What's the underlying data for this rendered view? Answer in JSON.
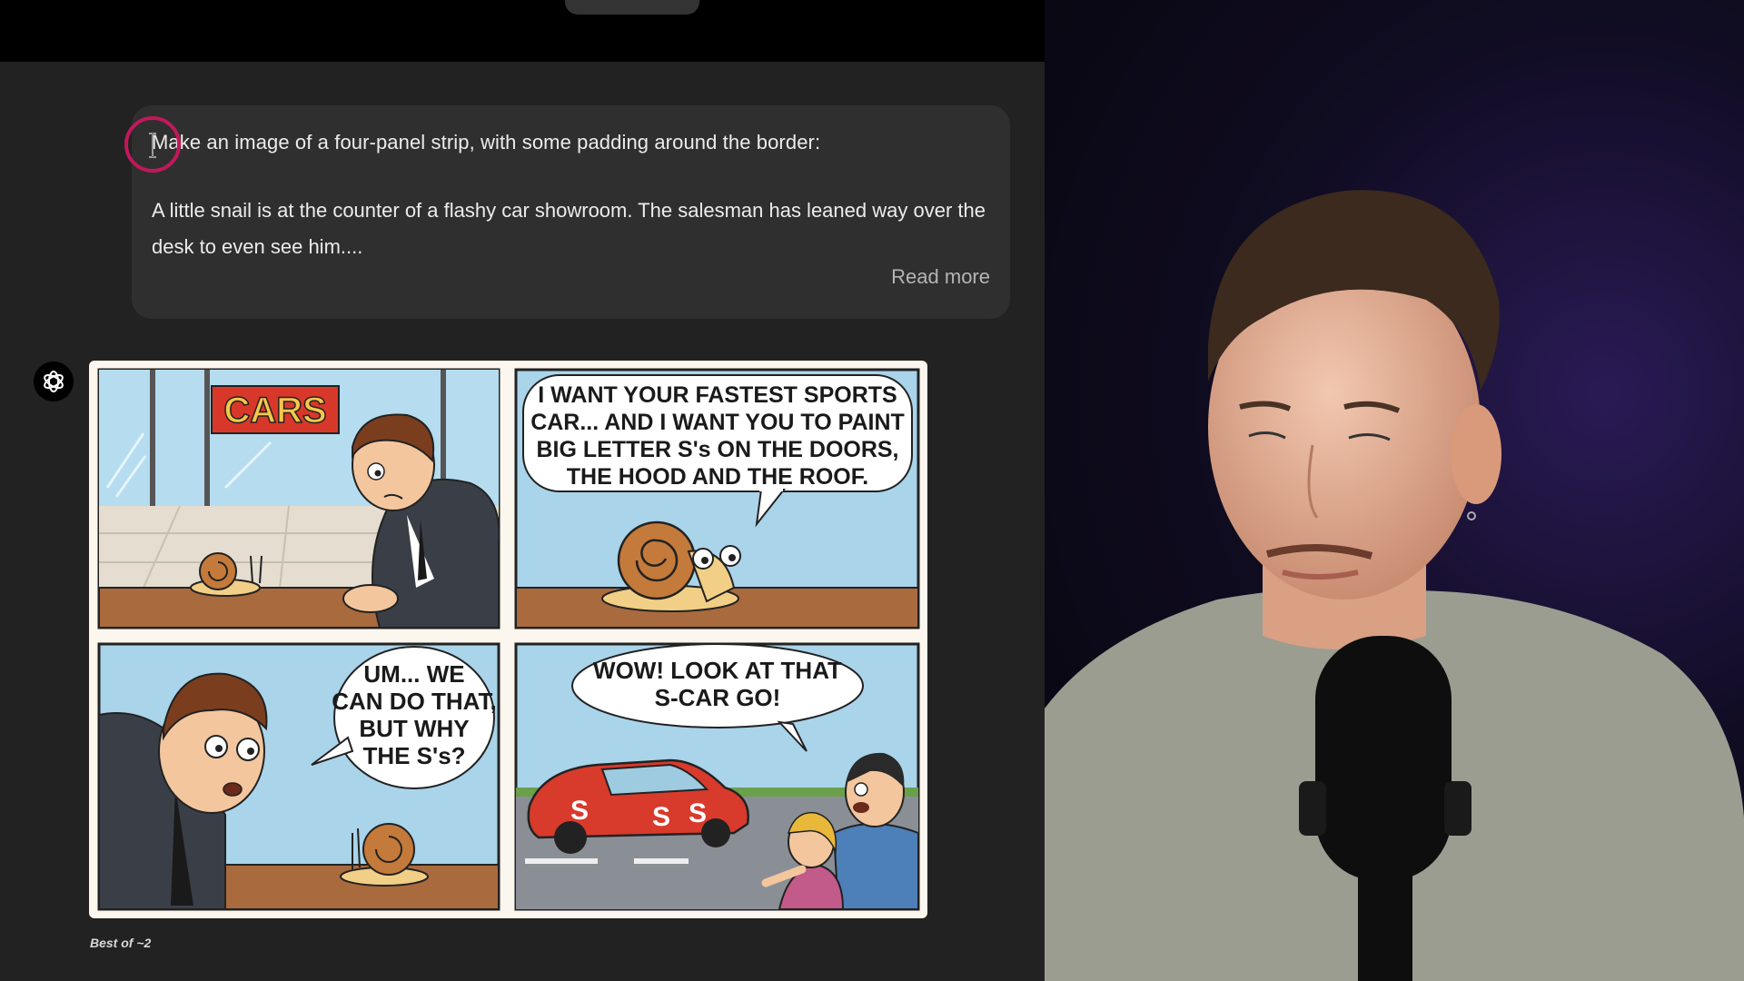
{
  "user_message": {
    "line1": "Make an image of a four-panel strip, with some padding around the border:",
    "body": "A little snail is at the counter of a flashy car showroom. The salesman has leaned way over the desk to even see him....",
    "read_more": "Read more"
  },
  "assistant": {
    "avatar_icon": "openai-logo-icon",
    "image_footer": "Best of ~2"
  },
  "comic": {
    "panel1": {
      "sign": "CARS"
    },
    "panel2": {
      "bubble": [
        "I WANT YOUR FASTEST SPORTS",
        "CAR... AND I WANT YOU TO PAINT",
        "BIG LETTER S's ON THE DOORS,",
        "THE HOOD AND THE ROOF."
      ]
    },
    "panel3": {
      "bubble": [
        "UM... WE",
        "CAN DO THAT,",
        "BUT WHY",
        "THE S's?"
      ]
    },
    "panel4": {
      "bubble": [
        "WOW! LOOK AT THAT",
        "S-CAR GO!"
      ],
      "car_letters": [
        "S",
        "S",
        "S"
      ]
    }
  },
  "colors": {
    "chat_bg": "#222222",
    "bubble_bg": "#2f2f2f",
    "cursor_ring": "#c2185b",
    "sky": "#a9d4ea",
    "counter": "#a96a3e",
    "car": "#d83a2c"
  }
}
